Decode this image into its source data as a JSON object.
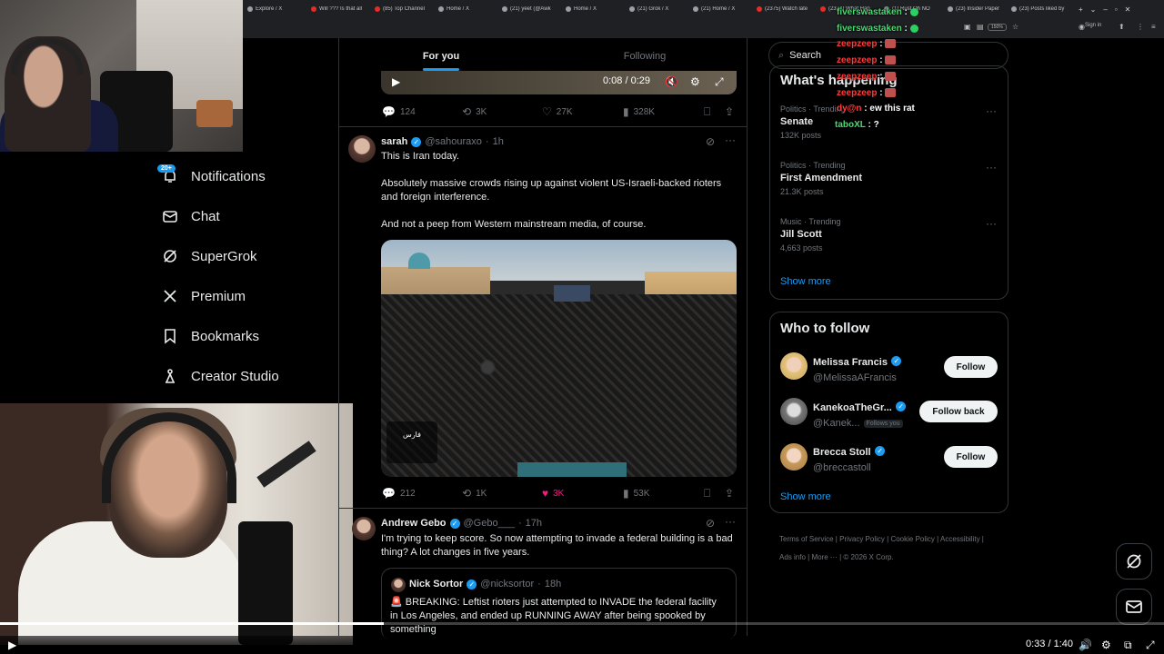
{
  "browser": {
    "tabs": [
      {
        "label": "Explore / X",
        "icon": "x-icon"
      },
      {
        "label": "Will ??? Is that all",
        "icon": "youtube-icon"
      },
      {
        "label": "(85) Top Channel",
        "icon": "youtube-icon"
      },
      {
        "label": "Home / X",
        "icon": "x-icon"
      },
      {
        "label": "(21) yeet (@Awk",
        "icon": "x-icon"
      },
      {
        "label": "Home / X",
        "icon": "x-icon"
      },
      {
        "label": "(21) Grok / X",
        "icon": "x-icon"
      },
      {
        "label": "(21) Home / X",
        "icon": "x-icon"
      },
      {
        "label": "(2375) Watch late",
        "icon": "youtube-icon"
      },
      {
        "label": "(2374) What Hap",
        "icon": "youtube-icon"
      },
      {
        "label": "(1) Rust Oh NO",
        "icon": "x-icon"
      },
      {
        "label": "(23) Insider Paper",
        "icon": "x-icon"
      },
      {
        "label": "(23) Posts liked by",
        "icon": "x-icon"
      }
    ],
    "zoom": "150%",
    "sign_in": "Sign in"
  },
  "nav": {
    "notifications_badge": "20+",
    "items": [
      {
        "label": "Notifications",
        "icon": "bell-icon"
      },
      {
        "label": "Chat",
        "icon": "mail-icon"
      },
      {
        "label": "SuperGrok",
        "icon": "grok-icon"
      },
      {
        "label": "Premium",
        "icon": "x-logo-icon"
      },
      {
        "label": "Bookmarks",
        "icon": "bookmark-icon"
      },
      {
        "label": "Creator Studio",
        "icon": "creator-icon"
      }
    ]
  },
  "feed": {
    "tabs": [
      "For you",
      "Following"
    ],
    "video": {
      "time": "0:08 / 0:29"
    },
    "post0_stats": {
      "replies": "124",
      "reposts": "3K",
      "likes": "27K",
      "views": "328K"
    },
    "post1": {
      "name": "sarah",
      "handle": "@sahouraxo",
      "time": "1h",
      "line1": "This is Iran today.",
      "line2": "Absolutely massive crowds rising up against violent US-Israeli-backed rioters and foreign interference.",
      "line3": "And not a peep from Western mainstream media, of course.",
      "image_watermark": "فارس",
      "stats": {
        "replies": "212",
        "reposts": "1K",
        "likes": "3K",
        "views": "53K"
      }
    },
    "post2": {
      "name": "Andrew Gebo",
      "handle": "@Gebo___",
      "time": "17h",
      "text": "I'm trying to keep score. So now attempting to invade a federal building is a bad thing? A lot changes in five years.",
      "quote": {
        "name": "Nick Sortor",
        "handle": "@nicksortor",
        "time": "18h",
        "text": "🚨 BREAKING: Leftist rioters just attempted to INVADE the federal facility in Los Angeles, and ended up RUNNING AWAY after being spooked by something"
      }
    }
  },
  "right": {
    "search_placeholder": "Search",
    "happening_title": "What's happening",
    "trends": [
      {
        "meta": "Politics · Trending",
        "name": "Senate",
        "posts": "132K posts"
      },
      {
        "meta": "Politics · Trending",
        "name": "First Amendment",
        "posts": "21.3K posts"
      },
      {
        "meta": "Music · Trending",
        "name": "Jill Scott",
        "posts": "4,663 posts"
      }
    ],
    "show_more": "Show more",
    "wtf_title": "Who to follow",
    "follow": [
      {
        "name": "Melissa Francis",
        "handle": "@MelissaAFrancis",
        "button": "Follow",
        "follows_you": ""
      },
      {
        "name": "KanekoaTheGr...",
        "handle": "@Kanek...",
        "button": "Follow back",
        "follows_you": "Follows you"
      },
      {
        "name": "Brecca Stoll",
        "handle": "@breccastoll",
        "button": "Follow",
        "follows_you": ""
      }
    ],
    "footer": [
      "Terms of Service",
      "Privacy Policy",
      "Cookie Policy",
      "Accessibility",
      "Ads info",
      "More ···",
      "© 2026 X Corp."
    ]
  },
  "chat": [
    {
      "user": "fiverswastaken",
      "msg": "",
      "color": "#3ee06b"
    },
    {
      "user": "fiverswastaken",
      "msg": "",
      "color": "#3ee06b"
    },
    {
      "user": "zeepzeep",
      "msg": "",
      "color": "#ff3b3b"
    },
    {
      "user": "zeepzeep",
      "msg": "",
      "color": "#ff3b3b"
    },
    {
      "user": "zeepzeep",
      "msg": "",
      "color": "#ff3b3b"
    },
    {
      "user": "zeepzeep",
      "msg": "",
      "color": "#ff3b3b"
    },
    {
      "user": "dy@n",
      "msg": "ew this rat",
      "color": "#ff3b3b"
    },
    {
      "user": "taboXL",
      "msg": "?",
      "color": "#3ee06b"
    }
  ],
  "player": {
    "time": "0:33 / 1:40",
    "progress": 0.33
  }
}
